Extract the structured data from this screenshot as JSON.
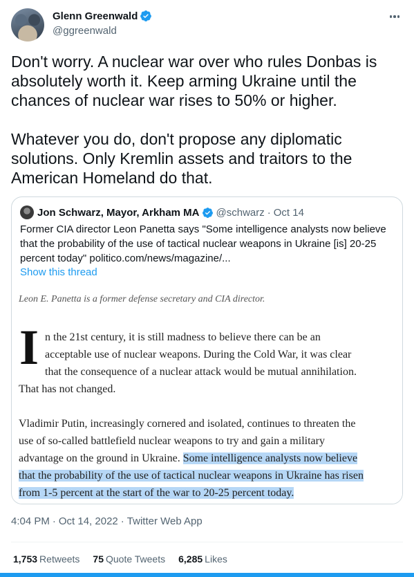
{
  "author": {
    "display_name": "Glenn Greenwald",
    "handle": "@ggreenwald"
  },
  "tweet": {
    "text": "Don't worry. A nuclear war over who rules Donbas is absolutely worth it. Keep arming Ukraine until the chances of nuclear war rises to 50% or higher.\n\nWhatever you do, don't propose any diplomatic solutions. Only Kremlin assets and traitors to the American Homeland do that."
  },
  "quote": {
    "display_name": "Jon Schwarz, Mayor, Arkham MA",
    "handle": "@schwarz",
    "separator": "·",
    "date": "Oct 14",
    "text": "Former CIA director Leon Panetta says \"Some intelligence analysts now believe that the probability of the use of tactical nuclear weapons in Ukraine [is] 20-25 percent today\" politico.com/news/magazine/...",
    "show_thread": "Show this thread",
    "article": {
      "byline": "Leon E. Panetta is a former defense secretary and CIA director.",
      "drop_cap": "I",
      "p1": [
        "n the 21st century, it is still madness to believe there can be an",
        "acceptable use of nuclear weapons. During the Cold War, it was clear",
        "that the consequence of a nuclear attack would be mutual annihilation.",
        "That has not changed."
      ],
      "p2_line1": "Vladimir Putin, increasingly cornered and isolated, continues to threaten the",
      "p2_line2": "use of so-called battlefield nuclear weapons to try and gain a military",
      "p2_line3_plain": "advantage on the ground in Ukraine. ",
      "p2_line3_hl": "Some intelligence analysts now believe",
      "p2_line4_hl": "that the probability of the use of tactical nuclear weapons in Ukraine has risen",
      "p2_line5_hl": "from 1-5 percent at the start of the war to 20-25 percent today."
    }
  },
  "meta": {
    "time": "4:04 PM",
    "separator": "·",
    "date": "Oct 14, 2022",
    "source": "Twitter Web App"
  },
  "stats": {
    "retweets_count": "1,753",
    "retweets_label": "Retweets",
    "quote_tweets_count": "75",
    "quote_tweets_label": "Quote Tweets",
    "likes_count": "6,285",
    "likes_label": "Likes"
  },
  "colors": {
    "accent": "#1d9bf0",
    "highlight": "#b6d7f6",
    "secondary_text": "#536471"
  }
}
